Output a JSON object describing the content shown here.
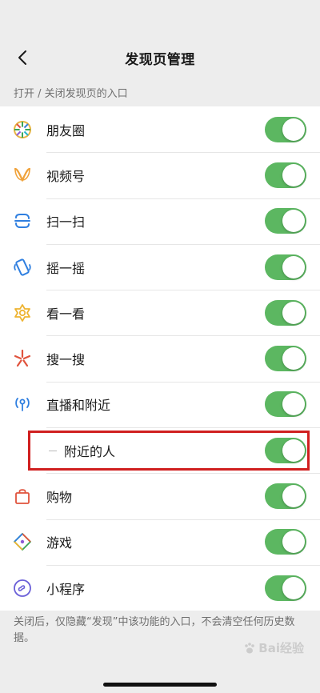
{
  "nav": {
    "title": "发现页管理"
  },
  "section": {
    "header": "打开 / 关闭发现页的入口"
  },
  "items": [
    {
      "label": "朋友圈",
      "icon": "moments-icon",
      "enabled": true,
      "sub": false
    },
    {
      "label": "视频号",
      "icon": "channels-icon",
      "enabled": true,
      "sub": false
    },
    {
      "label": "扫一扫",
      "icon": "scan-icon",
      "enabled": true,
      "sub": false
    },
    {
      "label": "摇一摇",
      "icon": "shake-icon",
      "enabled": true,
      "sub": false
    },
    {
      "label": "看一看",
      "icon": "top-stories-icon",
      "enabled": true,
      "sub": false
    },
    {
      "label": "搜一搜",
      "icon": "search-icon",
      "enabled": true,
      "sub": false
    },
    {
      "label": "直播和附近",
      "icon": "live-nearby-icon",
      "enabled": true,
      "sub": false
    },
    {
      "label": "附近的人",
      "icon": "",
      "enabled": true,
      "sub": true
    },
    {
      "label": "购物",
      "icon": "shopping-bag-icon",
      "enabled": true,
      "sub": false
    },
    {
      "label": "游戏",
      "icon": "games-icon",
      "enabled": true,
      "sub": false
    },
    {
      "label": "小程序",
      "icon": "mini-program-icon",
      "enabled": true,
      "sub": false
    }
  ],
  "footer": {
    "note": "关闭后，仅隐藏“发现”中该功能的入口，不会清空任何历史数据。"
  },
  "watermark": {
    "text": "Bai经验"
  },
  "colors": {
    "toggle_on": "#5cb761",
    "background": "#ededed",
    "highlight": "#d01f1f"
  }
}
